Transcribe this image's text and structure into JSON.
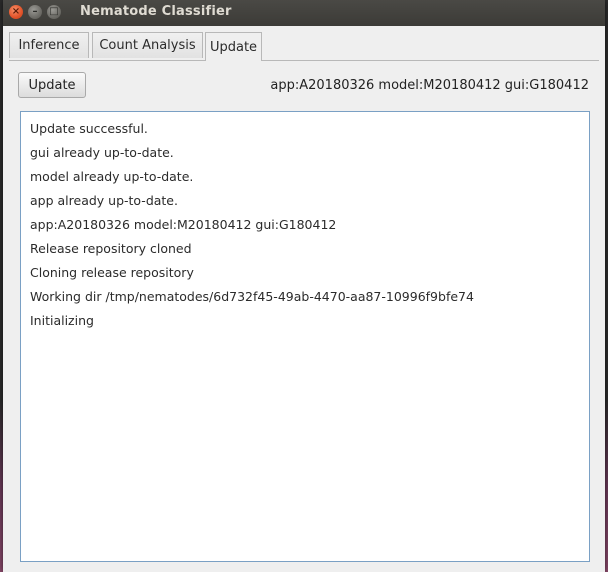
{
  "window": {
    "title": "Nematode Classifier",
    "close_glyph": "×",
    "minimize_glyph": "–",
    "maximize_glyph": "□"
  },
  "tabs": [
    {
      "label": "Inference",
      "active": false
    },
    {
      "label": "Count Analysis",
      "active": false
    },
    {
      "label": "Update",
      "active": true
    }
  ],
  "update_panel": {
    "update_button_label": "Update",
    "version_text": "app:A20180326 model:M20180412 gui:G180412",
    "log_lines": [
      "Update successful.",
      "gui already up-to-date.",
      "model already up-to-date.",
      "app already up-to-date.",
      "app:A20180326 model:M20180412 gui:G180412",
      "Release repository cloned",
      "Cloning release repository",
      "Working dir /tmp/nematodes/6d732f45-49ab-4470-aa87-10996f9bfe74",
      "Initializing"
    ]
  },
  "colors": {
    "titlebar": "#3c3b37",
    "close_button": "#e4572e",
    "log_border": "#7aa0c4",
    "window_bg": "#efefef"
  }
}
